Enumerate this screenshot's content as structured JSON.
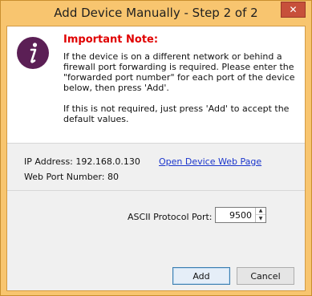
{
  "window": {
    "title": "Add Device Manually - Step 2 of 2",
    "close_glyph": "✕"
  },
  "note": {
    "icon": "info-italic-i-icon",
    "title": "Important Note:",
    "paragraph1": "If the device is on a different network or behind a firewall port forwarding is required. Please enter the \"forwarded port number\" for each port of the device below, then press 'Add'.",
    "paragraph2": "If this is not required, just press 'Add' to accept the default values."
  },
  "device": {
    "ip_label": "IP Address:",
    "ip_value": "192.168.0.130",
    "web_port_label": "Web Port Number:",
    "web_port_value": "80",
    "web_link": "Open Device Web Page"
  },
  "ascii": {
    "label": "ASCII Protocol Port:",
    "value": "9500"
  },
  "buttons": {
    "add": "Add",
    "cancel": "Cancel"
  }
}
